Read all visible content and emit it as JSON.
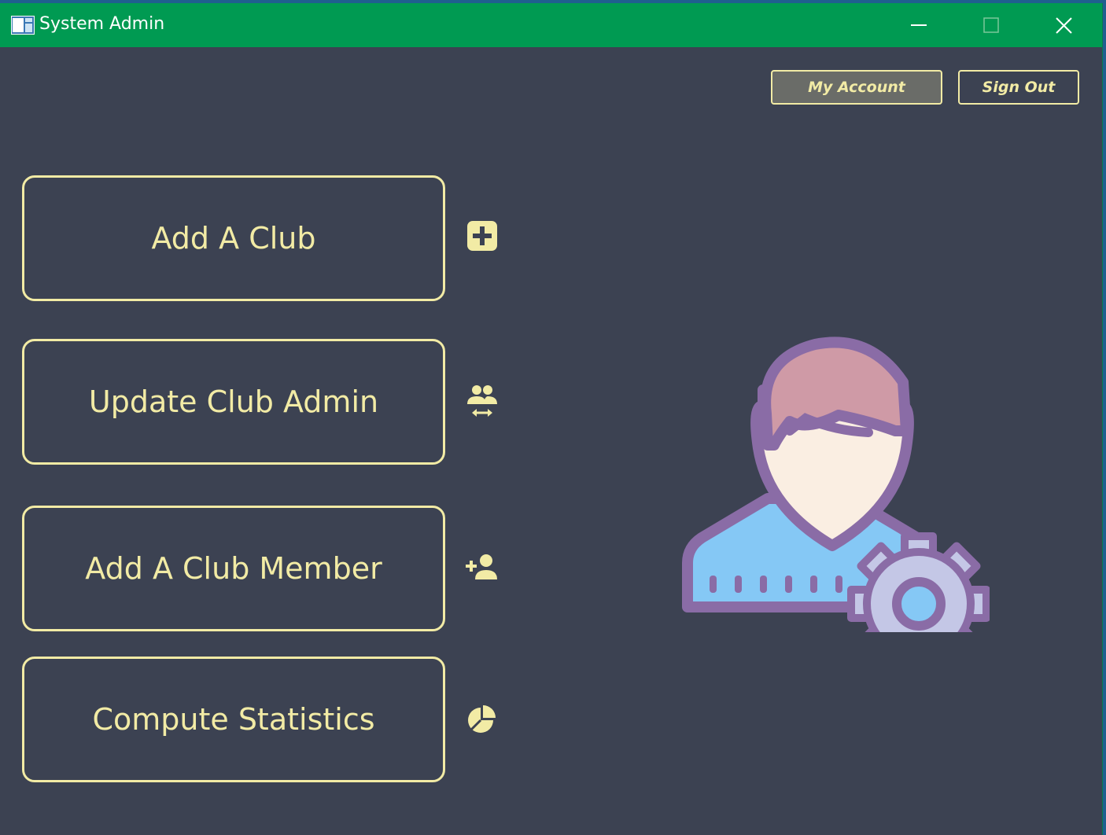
{
  "window": {
    "title": "System Admin",
    "controls": [
      "minimize",
      "maximize",
      "close"
    ]
  },
  "header": {
    "my_account_label": "My Account",
    "sign_out_label": "Sign Out"
  },
  "actions": [
    {
      "label": "Add A Club",
      "icon": "plus-square-icon"
    },
    {
      "label": "Update Club Admin",
      "icon": "users-swap-icon"
    },
    {
      "label": "Add A Club Member",
      "icon": "add-user-icon"
    },
    {
      "label": "Compute Statistics",
      "icon": "pie-chart-icon"
    }
  ],
  "illustration": {
    "icon": "admin-user-settings-icon"
  },
  "colors": {
    "titlebar": "#009a52",
    "background": "#3c4252",
    "accent": "#f2eba5",
    "my_account_bg": "#6a6c68"
  }
}
